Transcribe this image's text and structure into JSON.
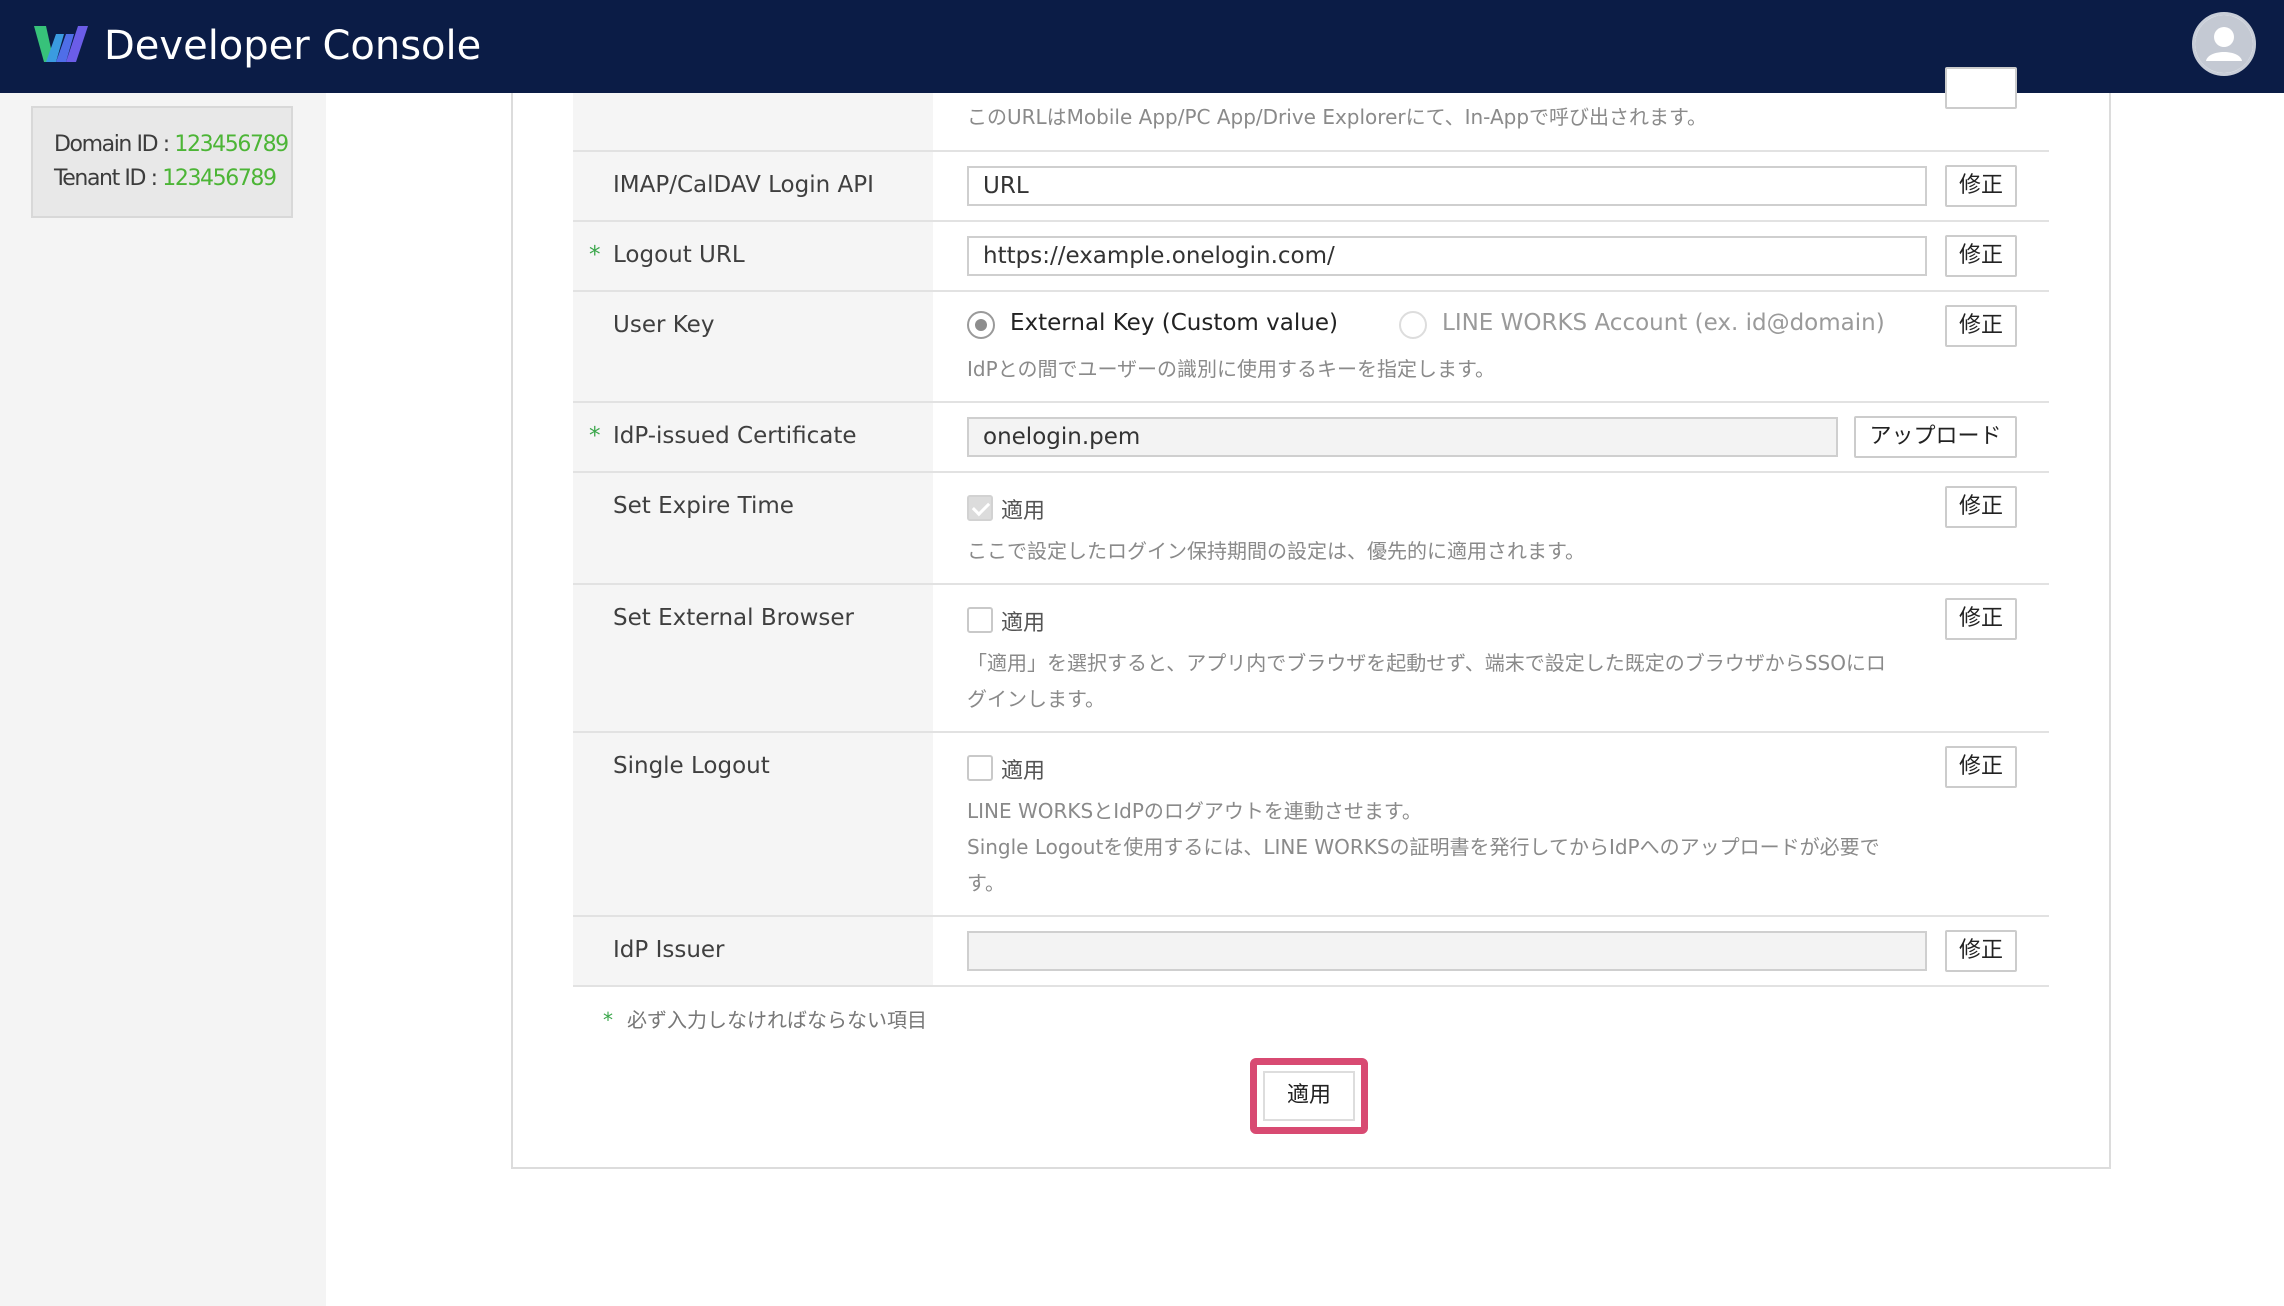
{
  "header": {
    "title": "Developer Console",
    "logo_icon": "line-works-logo-icon",
    "avatar_icon": "user-avatar-icon"
  },
  "sidebar": {
    "domain_label": "Domain ID : ",
    "domain_id": "123456789",
    "tenant_label": "Tenant ID : ",
    "tenant_id": "123456789"
  },
  "form": {
    "top_help": "このURLはMobile App/PC App/Drive Explorerにて、In-Appで呼び出されます。",
    "rows": [
      {
        "label": "IMAP/CalDAV Login API",
        "required": false,
        "value": "URL",
        "button": "修正"
      },
      {
        "label": "Logout URL",
        "required": true,
        "value": "https://example.onelogin.com/",
        "button": "修正"
      },
      {
        "label": "User Key",
        "required": false,
        "button": "修正",
        "options": [
          {
            "label": "External Key (Custom value)",
            "selected": true
          },
          {
            "label": "LINE WORKS Account (ex. id@domain)",
            "selected": false
          }
        ],
        "help": "IdPとの間でユーザーの識別に使用するキーを指定します。"
      },
      {
        "label": "IdP-issued Certificate",
        "required": true,
        "value": "onelogin.pem",
        "button": "アップロード"
      },
      {
        "label": "Set Expire Time",
        "required": false,
        "button": "修正",
        "checkbox_label": "適用",
        "checked": true,
        "help": "ここで設定したログイン保持期間の設定は、優先的に適用されます。"
      },
      {
        "label": "Set External Browser",
        "required": false,
        "button": "修正",
        "checkbox_label": "適用",
        "checked": false,
        "help_lines": [
          "「適用」を選択すると、アプリ内でブラウザを起動せず、端末で設定した既定のブラウザからSSOにロ",
          "グインします。"
        ]
      },
      {
        "label": "Single Logout",
        "required": false,
        "button": "修正",
        "checkbox_label": "適用",
        "checked": false,
        "help_lines": [
          "LINE WORKSとIdPのログアウトを連動させます。",
          "Single Logoutを使用するには、LINE WORKSの証明書を発行してからIdPへのアップロードが必要で",
          "す。"
        ]
      },
      {
        "label": "IdP Issuer",
        "required": false,
        "value": "",
        "button": "修正"
      }
    ],
    "required_star": "*",
    "footnote": "必ず入力しなければならない項目",
    "apply_label": "適用"
  }
}
